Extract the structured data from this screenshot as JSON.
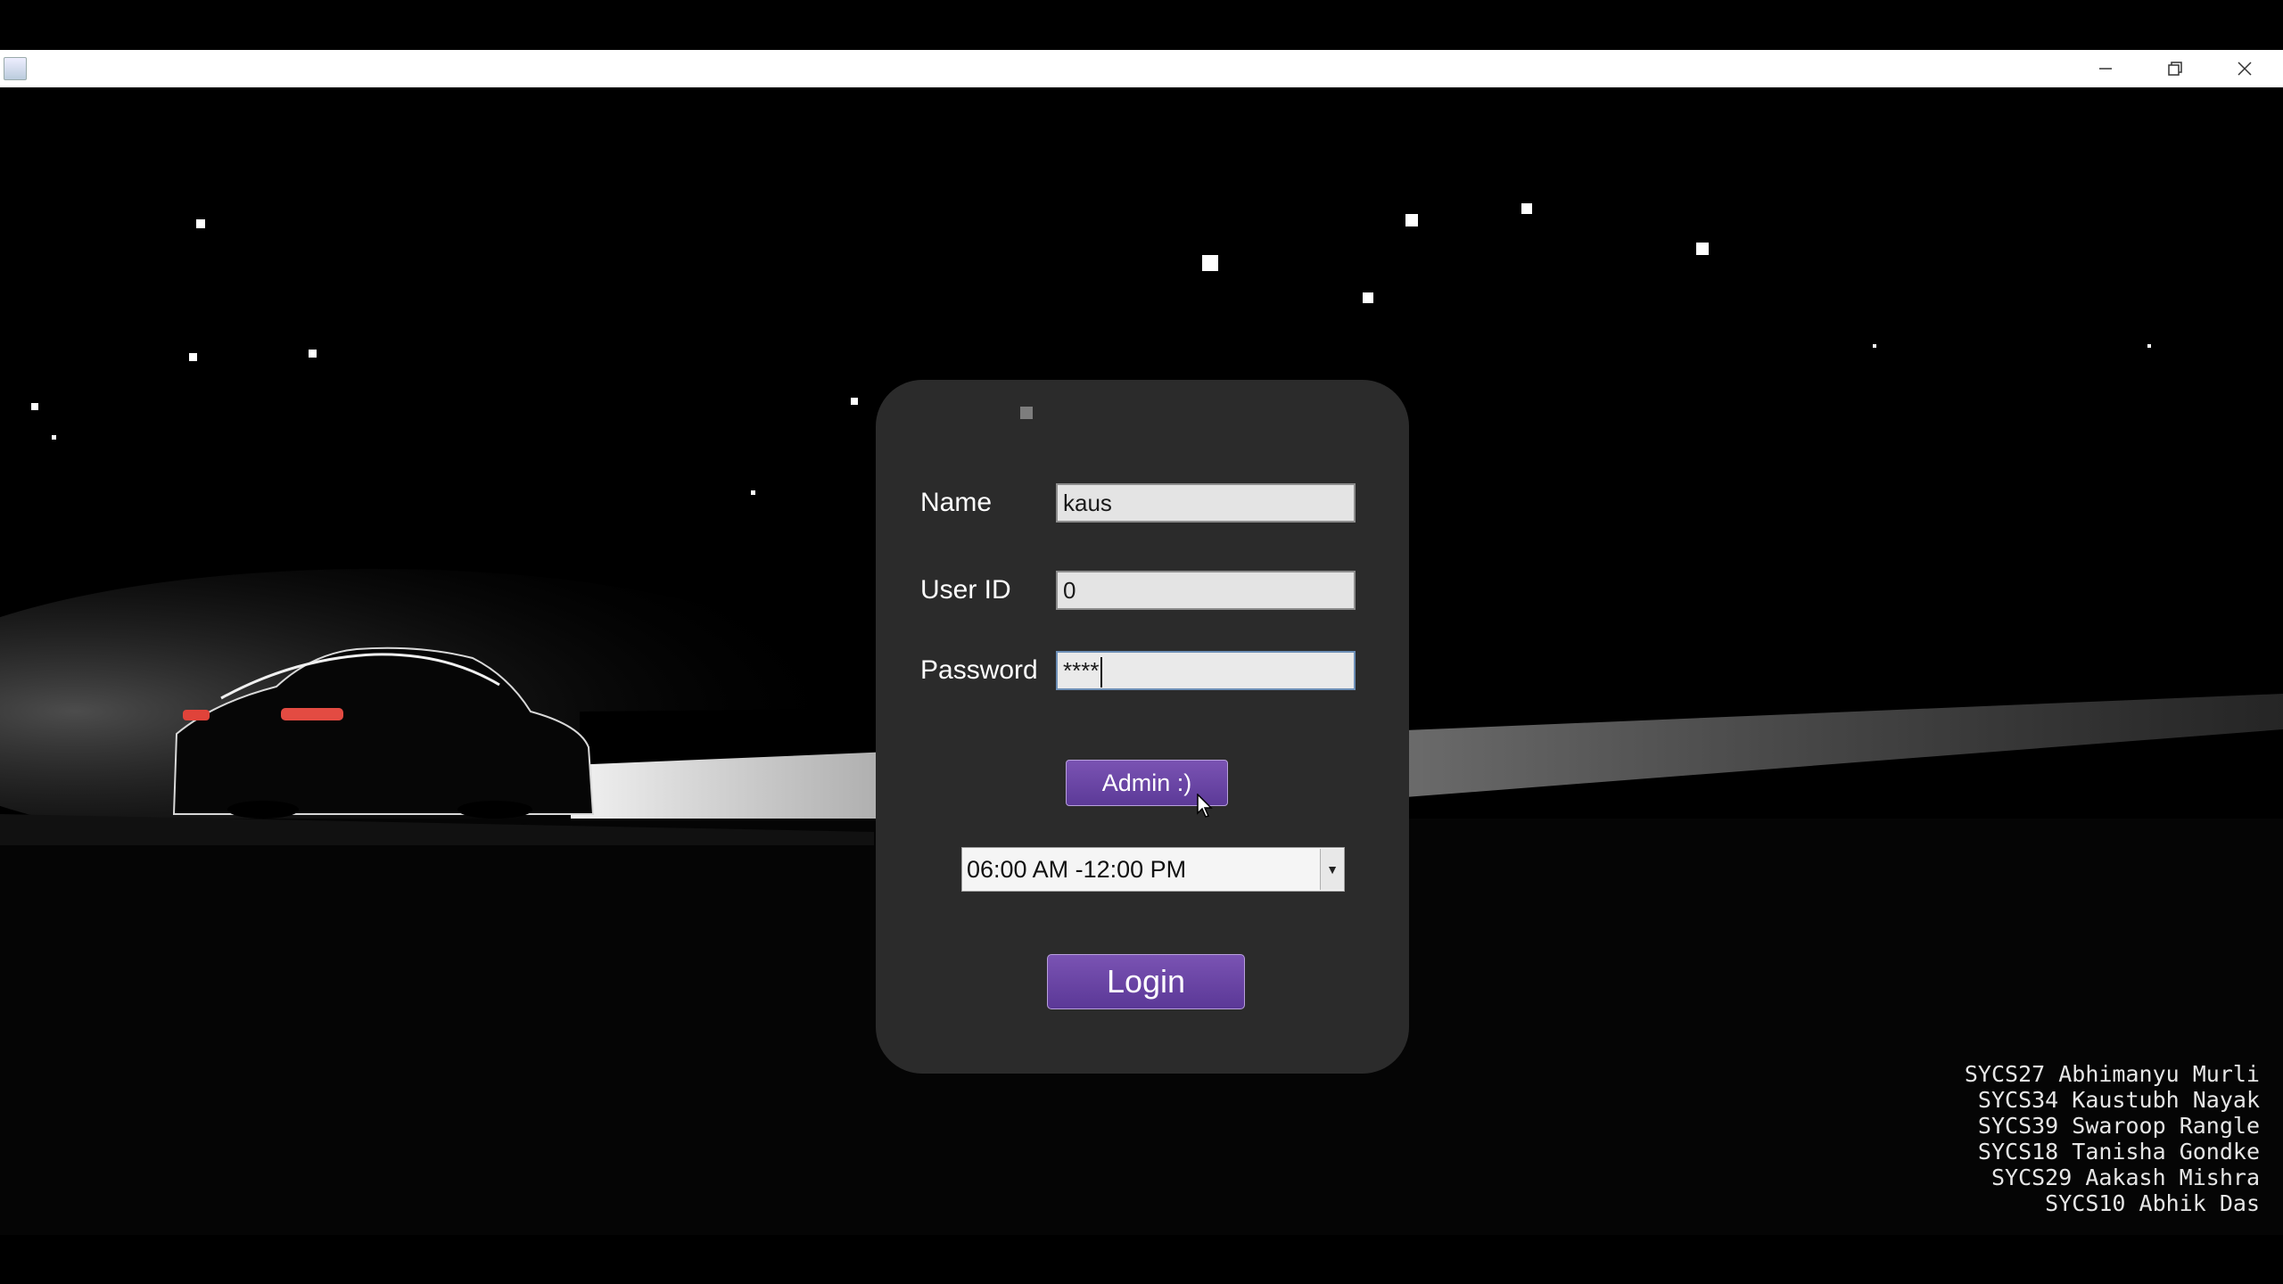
{
  "window": {
    "icon": "java-app-icon",
    "controls": [
      "minimize-icon",
      "restore-icon",
      "close-icon"
    ]
  },
  "login_form": {
    "name_label": "Name",
    "name_value": "kaus",
    "user_id_label": "User ID",
    "user_id_value": "0",
    "password_label": "Password",
    "password_value": "****",
    "admin_button": "Admin :)",
    "shift_select": {
      "selected": "06:00 AM -12:00 PM",
      "arrow_icon": "chevron-down-icon"
    },
    "login_button": "Login"
  },
  "credits": [
    "SYCS27 Abhimanyu Murli",
    "SYCS34 Kaustubh Nayak",
    "SYCS39 Swaroop Rangle",
    "SYCS18 Tanisha Gondke",
    "SYCS29 Aakash Mishra",
    "SYCS10 Abhik Das"
  ],
  "colors": {
    "accent": "#6a47a6",
    "panel": "#2b2b2b",
    "background": "#000000"
  }
}
